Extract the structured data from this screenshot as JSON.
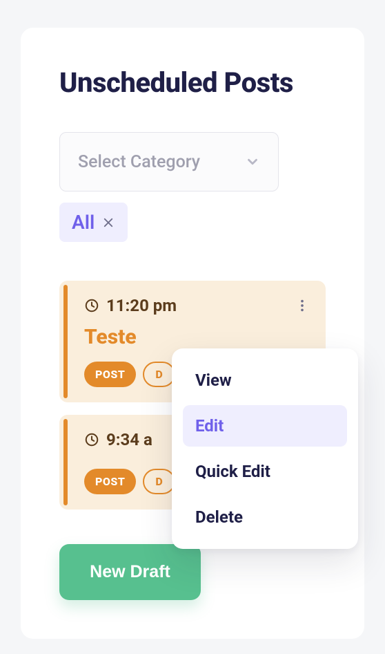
{
  "page": {
    "title": "Unscheduled Posts"
  },
  "category_select": {
    "placeholder": "Select Category"
  },
  "filter_chip": {
    "label": "All"
  },
  "posts": [
    {
      "time": "11:20 pm",
      "title": "Teste",
      "badges": {
        "solid": "POST",
        "outline_visible": "D"
      }
    },
    {
      "time": "9:34 a",
      "title": "",
      "badges": {
        "solid": "POST",
        "outline_visible": "D"
      }
    }
  ],
  "dropdown": {
    "items": [
      "View",
      "Edit",
      "Quick Edit",
      "Delete"
    ],
    "active_index": 1
  },
  "actions": {
    "new_draft": "New Draft"
  },
  "colors": {
    "accent_orange": "#e38a2a",
    "accent_purple": "#6f60ea",
    "accent_green": "#57c08f"
  }
}
